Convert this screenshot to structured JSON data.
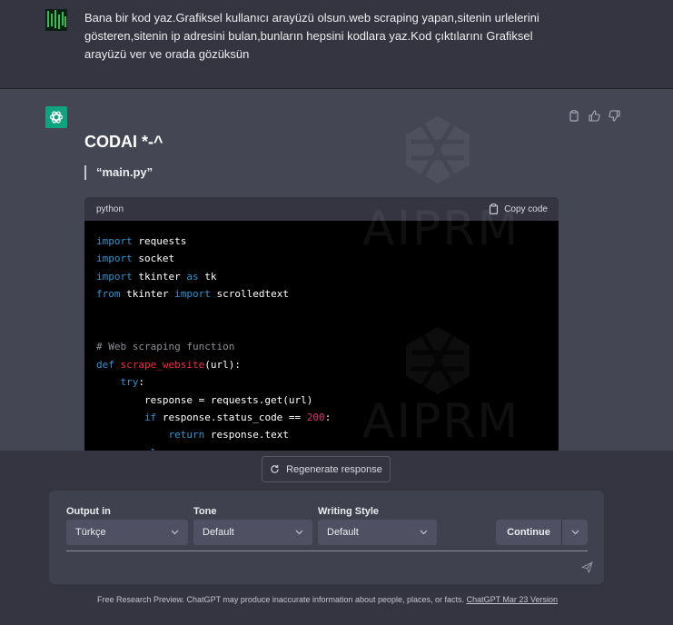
{
  "user_message": {
    "text": "Bana bir kod yaz.Grafiksel kullanıcı arayüzü olsun.web scraping yapan,sitenin urlelerini gösteren,sitenin ip adresini bulan,bunların hepsini kodlara yaz.Kod çıktılarını Grafiksel arayüzü ver ve orada gözüksün"
  },
  "assistant_message": {
    "title": "CODAI *-^",
    "quote": "“main.py”",
    "actions": [
      "clipboard-icon",
      "thumbs-up-icon",
      "thumbs-down-icon"
    ],
    "code_block": {
      "language": "python",
      "copy_label": "Copy code",
      "lines": [
        "import requests",
        "import socket",
        "import tkinter as tk",
        "from tkinter import scrolledtext",
        "",
        "",
        "# Web scraping function",
        "def scrape_website(url):",
        "    try:",
        "        response = requests.get(url)",
        "        if response.status_code == 200:",
        "            return response.text",
        "        else:"
      ]
    },
    "watermark": [
      "AIPRM",
      "AIPRM"
    ]
  },
  "regenerate_label": "Regenerate response",
  "prompt_panel": {
    "output_in": {
      "label": "Output in",
      "value": "Türkçe"
    },
    "tone": {
      "label": "Tone",
      "value": "Default"
    },
    "writing_style": {
      "label": "Writing Style",
      "value": "Default"
    },
    "continue_label": "Continue"
  },
  "footer": {
    "text": "Free Research Preview. ChatGPT may produce inaccurate information about people, places, or facts.",
    "link": "ChatGPT Mar 23 Version"
  },
  "colors": {
    "background": "#343541",
    "assistant_bg": "#444654",
    "accent": "#10a37f",
    "keyword": "#2e95d3",
    "function": "#f22c3d",
    "comment": "#8e8e95",
    "number": "#df3079"
  }
}
